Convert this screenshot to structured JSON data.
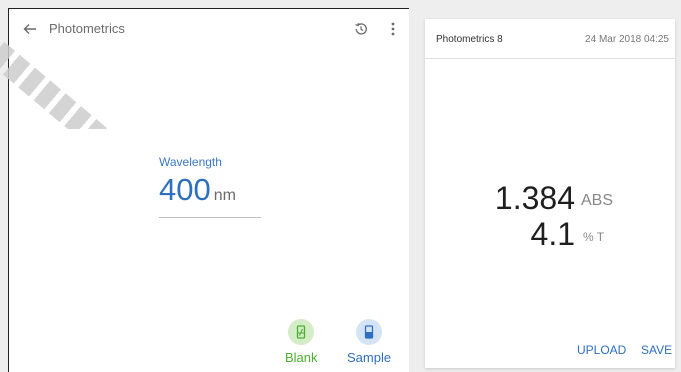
{
  "toolbar": {
    "title": "Photometrics",
    "back_icon": "arrow-left-icon",
    "history_icon": "history-icon",
    "more_icon": "more-vertical-icon"
  },
  "wavelength": {
    "label": "Wavelength",
    "value": "400",
    "unit": "nm"
  },
  "actions": {
    "blank_label": "Blank",
    "blank_icon": "blank-cuvette-icon",
    "sample_label": "Sample",
    "sample_icon": "sample-cuvette-icon"
  },
  "result": {
    "title": "Photometrics 8",
    "date": "24 Mar 2018 04:25",
    "absorbance_value": "1.384",
    "absorbance_unit": "ABS",
    "transmittance_value": "4.1",
    "transmittance_unit": "% T",
    "upload_label": "UPLOAD",
    "save_label": "SAVE"
  },
  "colors": {
    "accent": "#2f6fbf",
    "blank_green": "#4caf2f",
    "blank_bg": "#d4ecc7",
    "sample_bg": "#d4e4f5",
    "background": "#eeeeee"
  }
}
